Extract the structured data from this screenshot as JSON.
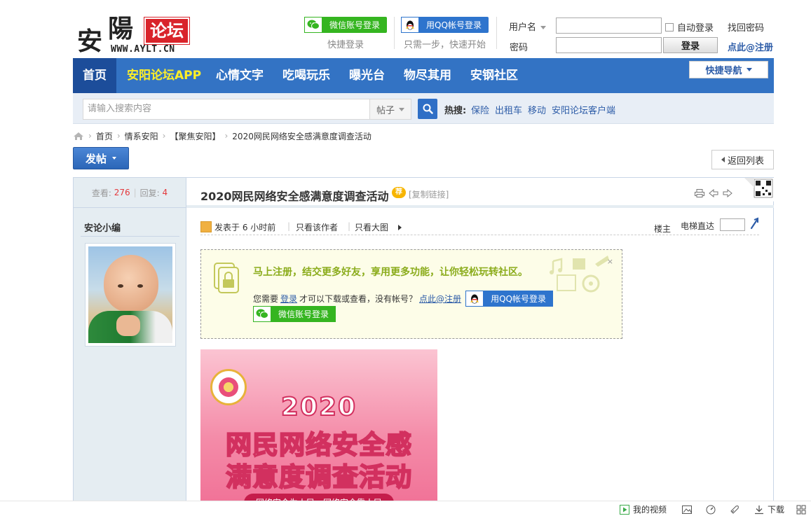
{
  "logo": {
    "char1": "安",
    "char2": "陽",
    "badge": "论坛",
    "url": "WWW.AYLT.CN"
  },
  "header": {
    "wechat_login": "微信账号登录",
    "wechat_sub": "快捷登录",
    "qq_login": "用QQ帐号登录",
    "qq_sub": "只需一步，快速开始",
    "username_label": "用户名",
    "password_label": "密码",
    "auto_login": "自动登录",
    "login_button": "登录",
    "find_password": "找回密码",
    "register": "点此@注册"
  },
  "nav": {
    "items": [
      "首页",
      "安阳论坛APP",
      "心情文字",
      "吃喝玩乐",
      "曝光台",
      "物尽其用",
      "安钢社区"
    ],
    "quick_nav": "快捷导航"
  },
  "search": {
    "placeholder": "请输入搜索内容",
    "type": "帖子",
    "hot_label": "热搜:",
    "hot_items": [
      "保险",
      "出租车",
      "移动",
      "安阳论坛客户端"
    ]
  },
  "breadcrumb": [
    "首页",
    "情系安阳",
    "【聚焦安阳】",
    "2020网民网络安全感满意度调查活动"
  ],
  "actions": {
    "post": "发帖",
    "back": "返回列表"
  },
  "thread": {
    "views_label": "查看:",
    "views": "276",
    "replies_label": "回复:",
    "replies": "4",
    "title": "2020网民网络安全感满意度调查活动",
    "ad_badge": "荐",
    "copy_link": "[复制链接]"
  },
  "author": {
    "name": "安论小编"
  },
  "post_meta": {
    "posted": "发表于 6 小时前",
    "only_author": "只看该作者",
    "view_big": "只看大图",
    "floor": "楼主",
    "elevator": "电梯直达"
  },
  "notice": {
    "headline": "马上注册，结交更多好友，享用更多功能，让你轻松玩转社区。",
    "need_prefix": "您需要",
    "login": "登录",
    "middle": "才可以下载或查看，没有帐号？",
    "register": "点此@注册",
    "qq_login": "用QQ帐号登录",
    "wechat_login": "微信账号登录",
    "close": "×"
  },
  "poster": {
    "year": "2020",
    "line1": "网民网络安全感",
    "line2": "满意度调查活动",
    "ribbon": "网络安全为人民，网络安全靠人民"
  },
  "bottombar": {
    "video": "我的视频",
    "download": "下载"
  },
  "colors": {
    "nav_blue": "#3373c4",
    "nav_active": "#1c4d9a",
    "app_yellow": "#ffef27",
    "wechat_green": "#35b520",
    "qq_blue": "#2e74cd",
    "count_red": "#e4393c",
    "notice_green": "#8bac1c"
  }
}
